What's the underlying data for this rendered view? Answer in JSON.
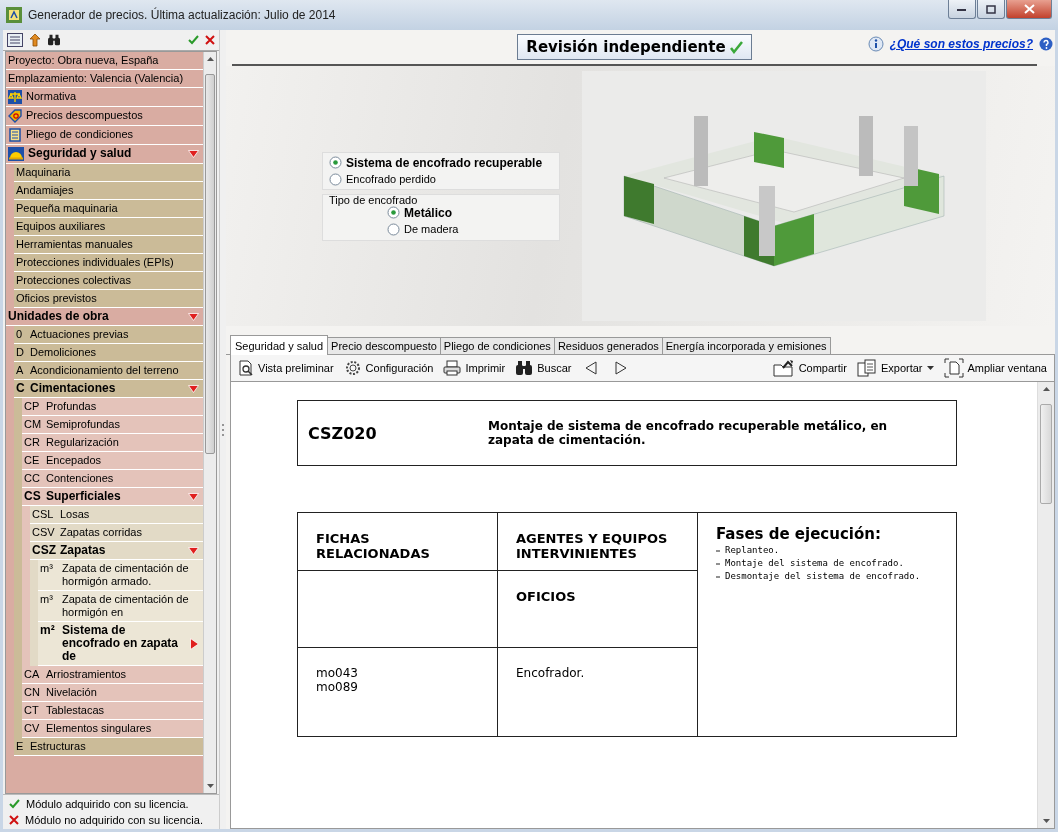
{
  "window": {
    "title": "Generador de precios. Última actualización: Julio de 2014"
  },
  "tree": [
    {
      "label": "Proyecto: Obra nueva, España"
    },
    {
      "label": "Emplazamiento: Valencia (Valencia)"
    },
    {
      "label": "Normativa",
      "kind": "law"
    },
    {
      "label": "Precios descompuestos",
      "kind": "prices"
    },
    {
      "label": "Pliego de condiciones",
      "kind": "specs"
    },
    {
      "label": "Seguridad y salud",
      "kind": "safety",
      "expanded": true,
      "children": [
        {
          "label": "Maquinaria"
        },
        {
          "label": "Andamiajes"
        },
        {
          "label": "Pequeña maquinaria"
        },
        {
          "label": "Equipos auxiliares"
        },
        {
          "label": "Herramientas manuales"
        },
        {
          "label": "Protecciones individuales (EPIs)"
        },
        {
          "label": "Protecciones colectivas"
        },
        {
          "label": "Oficios previstos"
        }
      ]
    },
    {
      "label": "Unidades de obra",
      "expanded": true,
      "children": [
        {
          "code": "0",
          "label": "Actuaciones previas"
        },
        {
          "code": "D",
          "label": "Demoliciones"
        },
        {
          "code": "A",
          "label": "Acondicionamiento del terreno"
        },
        {
          "code": "C",
          "label": "Cimentaciones",
          "expanded": true,
          "children": [
            {
              "code": "CP",
              "label": "Profundas"
            },
            {
              "code": "CM",
              "label": "Semiprofundas"
            },
            {
              "code": "CR",
              "label": "Regularización"
            },
            {
              "code": "CE",
              "label": "Encepados"
            },
            {
              "code": "CC",
              "label": "Contenciones"
            },
            {
              "code": "CS",
              "label": "Superficiales",
              "expanded": true,
              "children": [
                {
                  "code": "CSL",
                  "label": "Losas"
                },
                {
                  "code": "CSV",
                  "label": "Zapatas corridas"
                },
                {
                  "code": "CSZ",
                  "label": "Zapatas",
                  "expanded": true,
                  "children": [
                    {
                      "code": "m³",
                      "label": "Zapata de cimentación de hormigón armado.",
                      "selected": false
                    },
                    {
                      "code": "m³",
                      "label": "Zapata de cimentación de hormigón en",
                      "selected": false
                    },
                    {
                      "code": "m²",
                      "label": "Sistema de encofrado en zapata de",
                      "selected": true
                    }
                  ]
                }
              ]
            },
            {
              "code": "CA",
              "label": "Arriostramientos"
            },
            {
              "code": "CN",
              "label": "Nivelación"
            },
            {
              "code": "CT",
              "label": "Tablestacas"
            },
            {
              "code": "CV",
              "label": "Elementos singulares"
            }
          ]
        },
        {
          "code": "E",
          "label": "Estructuras"
        }
      ]
    }
  ],
  "legend": [
    {
      "kind": "acquired",
      "text": "Módulo adquirido con su licencia."
    },
    {
      "kind": "not_acquired",
      "text": "Módulo no adquirido con su licencia."
    }
  ],
  "header": {
    "badge": "Revisión independiente",
    "link": "¿Qué son estos precios?"
  },
  "options": {
    "radios": [
      {
        "label": "Sistema de encofrado recuperable",
        "selected": true
      },
      {
        "label": "Encofrado perdido",
        "selected": false
      }
    ],
    "group": {
      "title": "Tipo de encofrado",
      "radios": [
        {
          "label": "Metálico",
          "selected": true
        },
        {
          "label": "De madera",
          "selected": false
        }
      ]
    }
  },
  "tabs": [
    {
      "label": "Seguridad y salud",
      "selected": true
    },
    {
      "label": "Precio descompuesto",
      "selected": false
    },
    {
      "label": "Pliego de condiciones",
      "selected": false
    },
    {
      "label": "Residuos generados",
      "selected": false
    },
    {
      "label": "Energía incorporada y emisiones",
      "selected": false
    }
  ],
  "toolbar": {
    "left": [
      {
        "kind": "preview",
        "label": "Vista preliminar"
      },
      {
        "kind": "settings",
        "label": "Configuración"
      },
      {
        "kind": "print",
        "label": "Imprimir"
      },
      {
        "kind": "search",
        "label": "Buscar"
      }
    ],
    "right": [
      {
        "kind": "share",
        "label": "Compartir"
      },
      {
        "kind": "export",
        "label": "Exportar",
        "menu": true
      },
      {
        "kind": "expand",
        "label": "Ampliar ventana"
      }
    ]
  },
  "document": {
    "code": "CSZ020",
    "description": "Montaje de sistema de encofrado recuperable metálico, en zapata de cimentación.",
    "headers": [
      "FICHAS RELACIONADAS",
      "AGENTES Y EQUIPOS INTERVINIENTES"
    ],
    "subheader": "OFICIOS",
    "related": [
      "mo043",
      "mo089"
    ],
    "trade": "Encofrador.",
    "phases_title": "Fases de ejecución:",
    "phases": [
      "Replanteo.",
      "Montaje del sistema de encofrado.",
      "Desmontaje del sistema de encofrado."
    ]
  }
}
